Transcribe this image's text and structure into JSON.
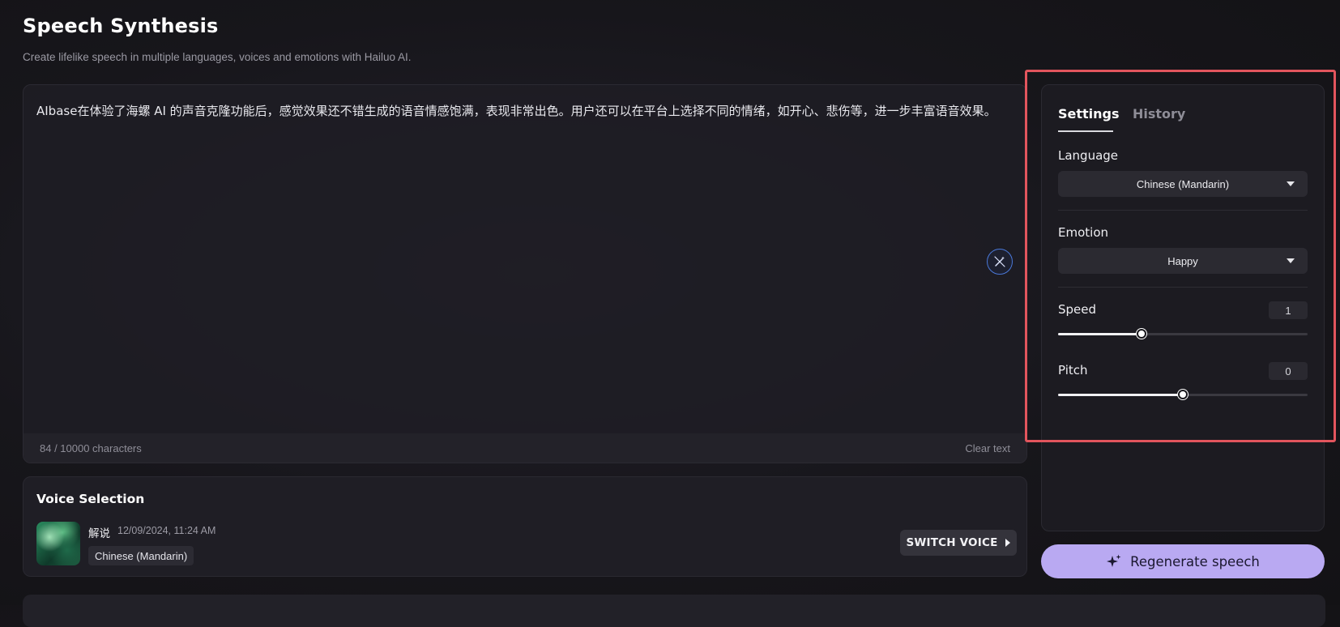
{
  "header": {
    "title": "Speech Synthesis",
    "subtitle": "Create lifelike speech in multiple languages, voices and emotions with Hailuo AI."
  },
  "editor": {
    "text": "AIbase在体验了海螺 AI 的声音克隆功能后，感觉效果还不错生成的语音情感饱满，表现非常出色。用户还可以在平台上选择不同的情绪，如开心、悲伤等，进一步丰富语音效果。",
    "char_count": "84 / 10000 characters",
    "clear_label": "Clear text",
    "magic_icon": "magic-wand-icon"
  },
  "voice": {
    "title": "Voice Selection",
    "name": "解说",
    "date": "12/09/2024, 11:24 AM",
    "language": "Chinese (Mandarin)",
    "switch_label": "SWITCH VOICE"
  },
  "settings": {
    "tabs": [
      "Settings",
      "History"
    ],
    "language_label": "Language",
    "language_value": "Chinese (Mandarin)",
    "emotion_label": "Emotion",
    "emotion_value": "Happy",
    "speed_label": "Speed",
    "speed_value": "1",
    "speed_fraction": 0.333,
    "pitch_label": "Pitch",
    "pitch_value": "0",
    "pitch_fraction": 0.5
  },
  "actions": {
    "regenerate_label": "Regenerate speech"
  },
  "colors": {
    "accent": "#b9a9f2",
    "highlight": "#e2555d"
  }
}
